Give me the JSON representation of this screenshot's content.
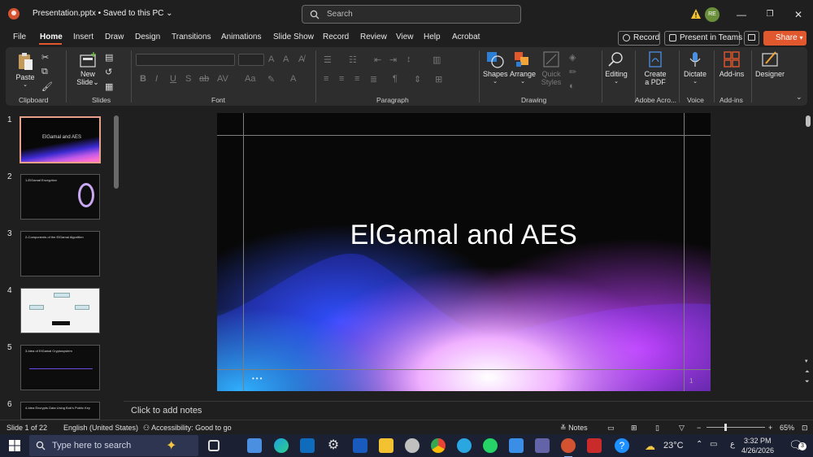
{
  "titlebar": {
    "doc_title": "Presentation.pptx • Saved to this PC",
    "search_placeholder": "Search",
    "avatar_initials": "RE"
  },
  "tabs": [
    "File",
    "Home",
    "Insert",
    "Draw",
    "Design",
    "Transitions",
    "Animations",
    "Slide Show",
    "Record",
    "Review",
    "View",
    "Help",
    "Acrobat"
  ],
  "tab_actions": {
    "record": "Record",
    "present_teams": "Present in Teams",
    "share": "Share"
  },
  "ribbon": {
    "clipboard": {
      "paste": "Paste",
      "label": "Clipboard"
    },
    "slides": {
      "new_slide_line1": "New",
      "new_slide_line2": "Slide",
      "label": "Slides"
    },
    "font": {
      "label": "Font"
    },
    "paragraph": {
      "label": "Paragraph"
    },
    "drawing": {
      "shapes": "Shapes",
      "arrange": "Arrange",
      "quick_styles_line1": "Quick",
      "quick_styles_line2": "Styles",
      "label": "Drawing"
    },
    "editing": {
      "label_btn": "Editing"
    },
    "adobe": {
      "create_pdf_line1": "Create",
      "create_pdf_line2": "a PDF",
      "label": "Adobe Acro..."
    },
    "voice": {
      "dictate": "Dictate",
      "label": "Voice"
    },
    "addins": {
      "addins": "Add-ins",
      "label": "Add-ins"
    },
    "designer": {
      "designer": "Designer"
    }
  },
  "thumbnails": [
    {
      "num": "1",
      "title": "ElGamal and AES"
    },
    {
      "num": "2",
      "title": "1-ElGamal Encryption"
    },
    {
      "num": "3",
      "title": "2-Components of the ElGamal Algorithm"
    },
    {
      "num": "4",
      "title": ""
    },
    {
      "num": "5",
      "title": "3-Idea of ElGamal Cryptosystem"
    },
    {
      "num": "6",
      "title": "4-Idea Encrypts Data Using Bob's Public Key"
    }
  ],
  "slide": {
    "title": "ElGamal and AES",
    "page_number": "1",
    "dots": "•••"
  },
  "notes_placeholder": "Click to add notes",
  "status": {
    "slide_count": "Slide 1 of 22",
    "language": "English (United States)",
    "accessibility": "Accessibility: Good to go",
    "notes": "Notes",
    "zoom": "65%"
  },
  "taskbar": {
    "search_placeholder": "Type here to search",
    "weather": "23°C",
    "time": "3:32 PM",
    "date": "4/26/2026",
    "notification_count": "3"
  },
  "colors": {
    "accent": "#e1582f",
    "background": "#1f1f1f",
    "ribbon": "#2d2d2d",
    "taskbar": "#1b2033"
  }
}
